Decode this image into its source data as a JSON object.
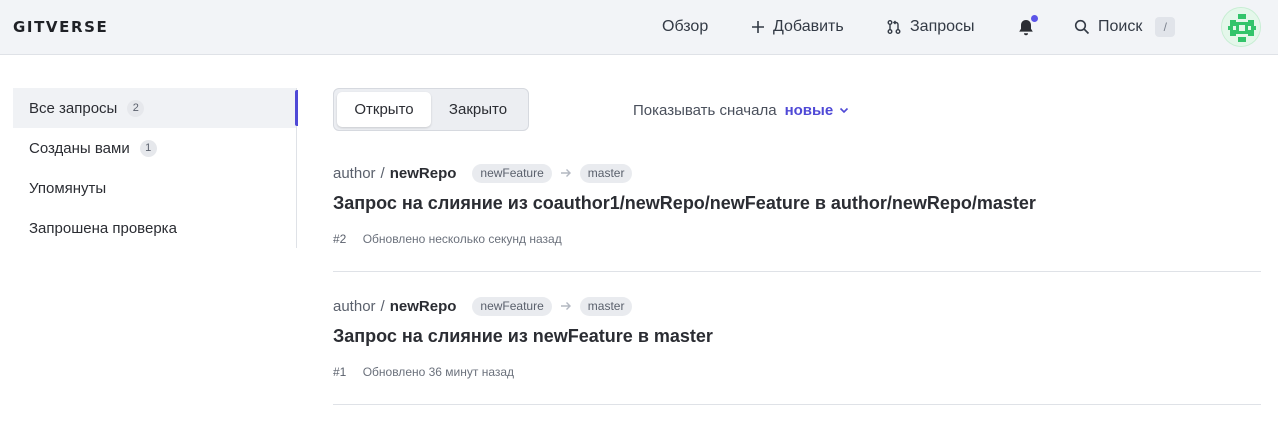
{
  "header": {
    "logo": "GITVERSE",
    "nav": {
      "overview": "Обзор",
      "add": "Добавить",
      "requests": "Запросы",
      "search": "Поиск",
      "search_shortcut": "/"
    },
    "notification_dot_color": "#5b54e8"
  },
  "sidebar": {
    "items": [
      {
        "label": "Все запросы",
        "count": "2",
        "active": true
      },
      {
        "label": "Созданы вами",
        "count": "1"
      },
      {
        "label": "Упомянуты"
      },
      {
        "label": "Запрошена проверка"
      }
    ]
  },
  "tabs": {
    "open": "Открыто",
    "closed": "Закрыто",
    "selected": "open"
  },
  "sort": {
    "label": "Показывать сначала",
    "value": "новые"
  },
  "pull_requests": [
    {
      "owner": "author",
      "repo": "newRepo",
      "from_branch": "newFeature",
      "to_branch": "master",
      "title": "Запрос на слияние из coauthor1/newRepo/newFeature в author/newRepo/master",
      "number": "#2",
      "updated": "Обновлено несколько секунд назад"
    },
    {
      "owner": "author",
      "repo": "newRepo",
      "from_branch": "newFeature",
      "to_branch": "master",
      "title": "Запрос на слияние из newFeature в master",
      "number": "#1",
      "updated": "Обновлено 36 минут назад"
    }
  ],
  "colors": {
    "accent": "#4f49d6",
    "header_bg": "#f2f4f7"
  }
}
